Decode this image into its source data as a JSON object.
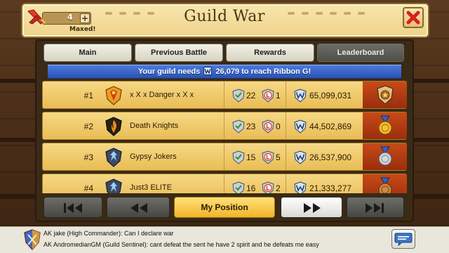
{
  "header": {
    "title": "Guild War",
    "counter_value": "4",
    "counter_plus": "+",
    "counter_caption": "Maxed!"
  },
  "tabs": [
    {
      "label": "Main",
      "active": false
    },
    {
      "label": "Previous Battle",
      "active": false
    },
    {
      "label": "Rewards",
      "active": false
    },
    {
      "label": "Leaderboard",
      "active": true
    }
  ],
  "banner": {
    "prefix": "Your guild needs",
    "points": "26,079",
    "suffix": "to reach Ribbon G!"
  },
  "rows": [
    {
      "rank": "#1",
      "name": "x X x Danger x X x",
      "wins": "22",
      "losses": "1",
      "score": "65,099,031",
      "emblem": "phoenix-emblem",
      "medal": "bronze-shield-medal"
    },
    {
      "rank": "#2",
      "name": "Death Knights",
      "wins": "23",
      "losses": "0",
      "score": "44,502,869",
      "emblem": "dark-flame-emblem",
      "medal": "gold-medal"
    },
    {
      "rank": "#3",
      "name": "Gypsy Jokers",
      "wins": "15",
      "losses": "5",
      "score": "26,537,900",
      "emblem": "ice-wing-emblem",
      "medal": "silver-medal"
    },
    {
      "rank": "#4",
      "name": "Just3 ELITE",
      "wins": "16",
      "losses": "2",
      "score": "21,333,277",
      "emblem": "ice-wing-emblem",
      "medal": "bronze-medal"
    }
  ],
  "pager": {
    "my_position": "My Position"
  },
  "chat": {
    "line1": "AK jake (High Commander): Can I declare war",
    "line2": "AK AndromedianGM (Guild Sentinel): cant defeat the sent he have 2 spirit and he defeats me easy"
  },
  "colors": {
    "parchment": "#f2dc98",
    "row_gold": "#efc865",
    "banner_blue": "#3464c8",
    "medal_red": "#b83c14",
    "win_green": "#5fa84a",
    "loss_red": "#d83c2c"
  }
}
